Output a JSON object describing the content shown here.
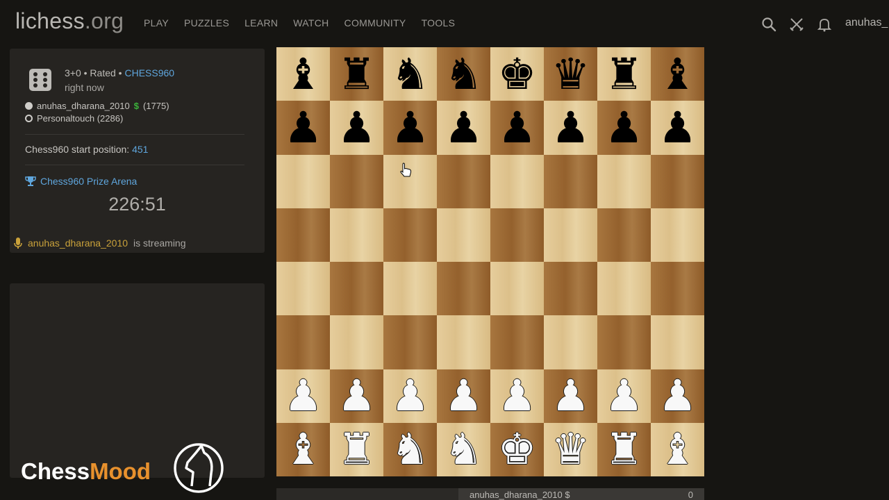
{
  "header": {
    "logo_main": "lichess",
    "logo_tld": ".org",
    "nav": [
      "PLAY",
      "PUZZLES",
      "LEARN",
      "WATCH",
      "COMMUNITY",
      "TOOLS"
    ],
    "username": "anuhas_"
  },
  "game": {
    "time_control": "3+0 • Rated • ",
    "variant": "CHESS960",
    "when": "right now",
    "white_player": "anuhas_dharana_2010",
    "white_patron": "$",
    "white_rating": "(1775)",
    "black_player": "Personaltouch (2286)",
    "start_label": "Chess960 start position: ",
    "start_number": "451",
    "arena_name": "Chess960 Prize Arena",
    "arena_clock": "226:51",
    "streamer": "anuhas_dharana_2010",
    "streaming_text": "is streaming"
  },
  "board": {
    "light_color": "#e0c796",
    "dark_color": "#9c6a35",
    "ranks": [
      [
        "bB",
        "bR",
        "bN",
        "bN",
        "bK",
        "bQ",
        "bR",
        "bB"
      ],
      [
        "bP",
        "bP",
        "bP",
        "bP",
        "bP",
        "bP",
        "bP",
        "bP"
      ],
      [
        "",
        "",
        "",
        "",
        "",
        "",
        "",
        ""
      ],
      [
        "",
        "",
        "",
        "",
        "",
        "",
        "",
        ""
      ],
      [
        "",
        "",
        "",
        "",
        "",
        "",
        "",
        ""
      ],
      [
        "",
        "",
        "",
        "",
        "",
        "",
        "",
        ""
      ],
      [
        "wP",
        "wP",
        "wP",
        "wP",
        "wP",
        "wP",
        "wP",
        "wP"
      ],
      [
        "wB",
        "wR",
        "wN",
        "wN",
        "wK",
        "wQ",
        "wR",
        "wB"
      ]
    ]
  },
  "bottom_player": {
    "name": "anuhas_dharana_2010 $",
    "score": "0"
  },
  "watermark": {
    "part1": "Chess",
    "part2": "Mood"
  },
  "icons": [
    "dice-icon",
    "trophy-icon",
    "microphone-icon",
    "search-icon",
    "swords-icon",
    "bell-icon",
    "hand-cursor-icon",
    "knight-logo-icon"
  ]
}
